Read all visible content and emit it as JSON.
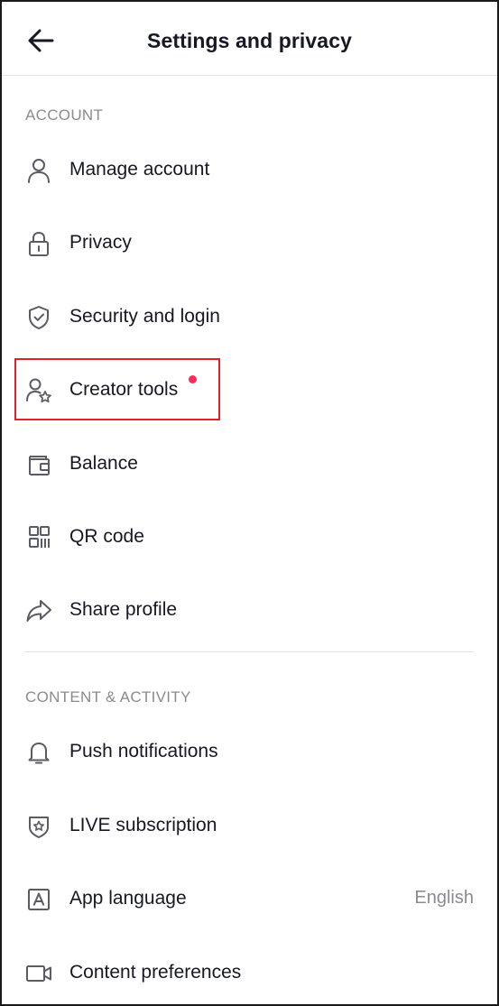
{
  "header": {
    "title": "Settings and privacy",
    "back_icon": "arrow-left-icon"
  },
  "account": {
    "section_label": "ACCOUNT",
    "items": [
      {
        "label": "Manage account",
        "icon": "person-icon"
      },
      {
        "label": "Privacy",
        "icon": "lock-icon"
      },
      {
        "label": "Security and login",
        "icon": "shield-check-icon"
      },
      {
        "label": "Creator tools",
        "icon": "person-star-icon",
        "has_notification_dot": true
      },
      {
        "label": "Balance",
        "icon": "wallet-icon"
      },
      {
        "label": "QR code",
        "icon": "qr-code-icon"
      },
      {
        "label": "Share profile",
        "icon": "share-arrow-icon"
      }
    ]
  },
  "content_activity": {
    "section_label": "CONTENT & ACTIVITY",
    "items": [
      {
        "label": "Push notifications",
        "icon": "bell-icon"
      },
      {
        "label": "LIVE subscription",
        "icon": "badge-star-icon"
      },
      {
        "label": "App language",
        "icon": "language-a-icon",
        "value": "English"
      },
      {
        "label": "Content preferences",
        "icon": "video-camera-icon"
      }
    ]
  },
  "colors": {
    "text_primary": "#161823",
    "text_secondary": "#8a8b91",
    "notification_dot": "#fe2c55",
    "highlight_border": "#e0202a",
    "divider": "#e3e3e4"
  }
}
